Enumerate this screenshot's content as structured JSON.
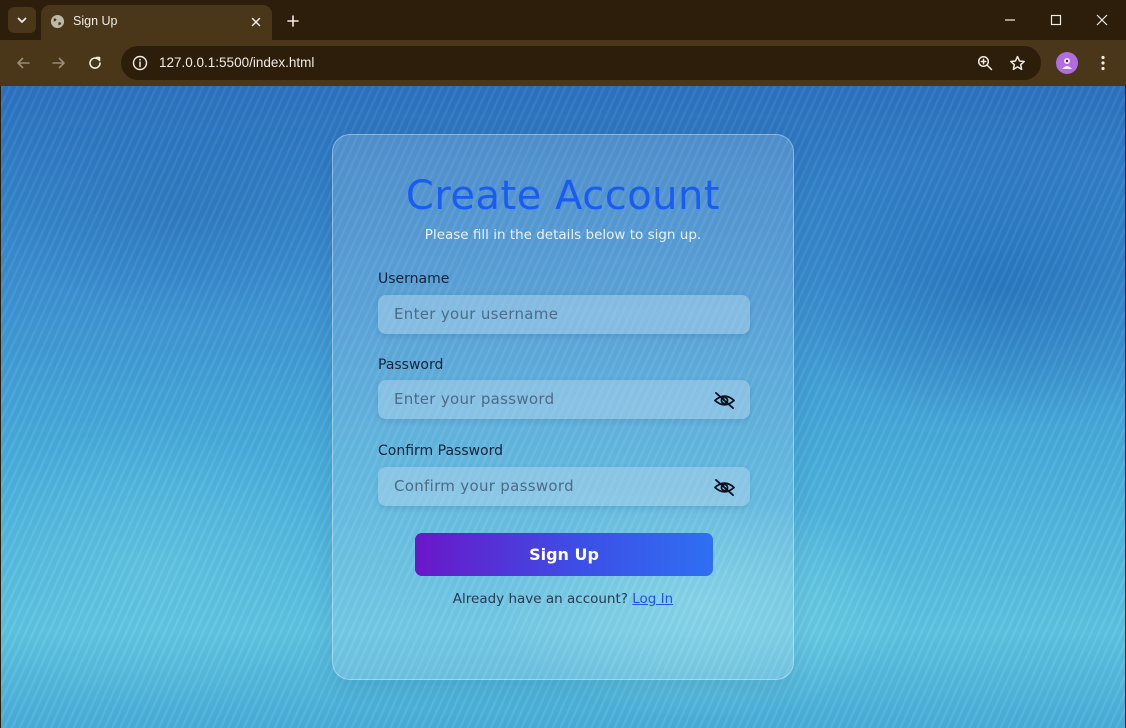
{
  "browser": {
    "tab_title": "Sign Up",
    "url": "127.0.0.1:5500/index.html"
  },
  "form": {
    "title": "Create Account",
    "subtitle": "Please fill in the details below to sign up.",
    "username_label": "Username",
    "username_placeholder": "Enter your username",
    "password_label": "Password",
    "password_placeholder": "Enter your password",
    "confirm_label": "Confirm Password",
    "confirm_placeholder": "Confirm your password",
    "submit_label": "Sign Up",
    "login_prompt": "Already have an account?",
    "login_link": "Log In"
  },
  "colors": {
    "title": "#1a5cf2",
    "button_start": "#6a17c8",
    "button_end": "#2f6ff2",
    "chrome_dark": "#2c1e0b",
    "chrome_toolbar": "#4a3618"
  },
  "icons": {
    "tab_menu": "chevron-down-icon",
    "favicon": "globe-icon",
    "tab_close": "close-icon",
    "new_tab": "plus-icon",
    "back": "back-arrow-icon",
    "forward": "forward-arrow-icon",
    "reload": "reload-icon",
    "site_info": "info-icon",
    "zoom": "zoom-icon",
    "bookmark": "star-icon",
    "profile": "avatar-icon",
    "menu": "kebab-menu-icon",
    "password_toggle": "eye-slash-icon"
  }
}
